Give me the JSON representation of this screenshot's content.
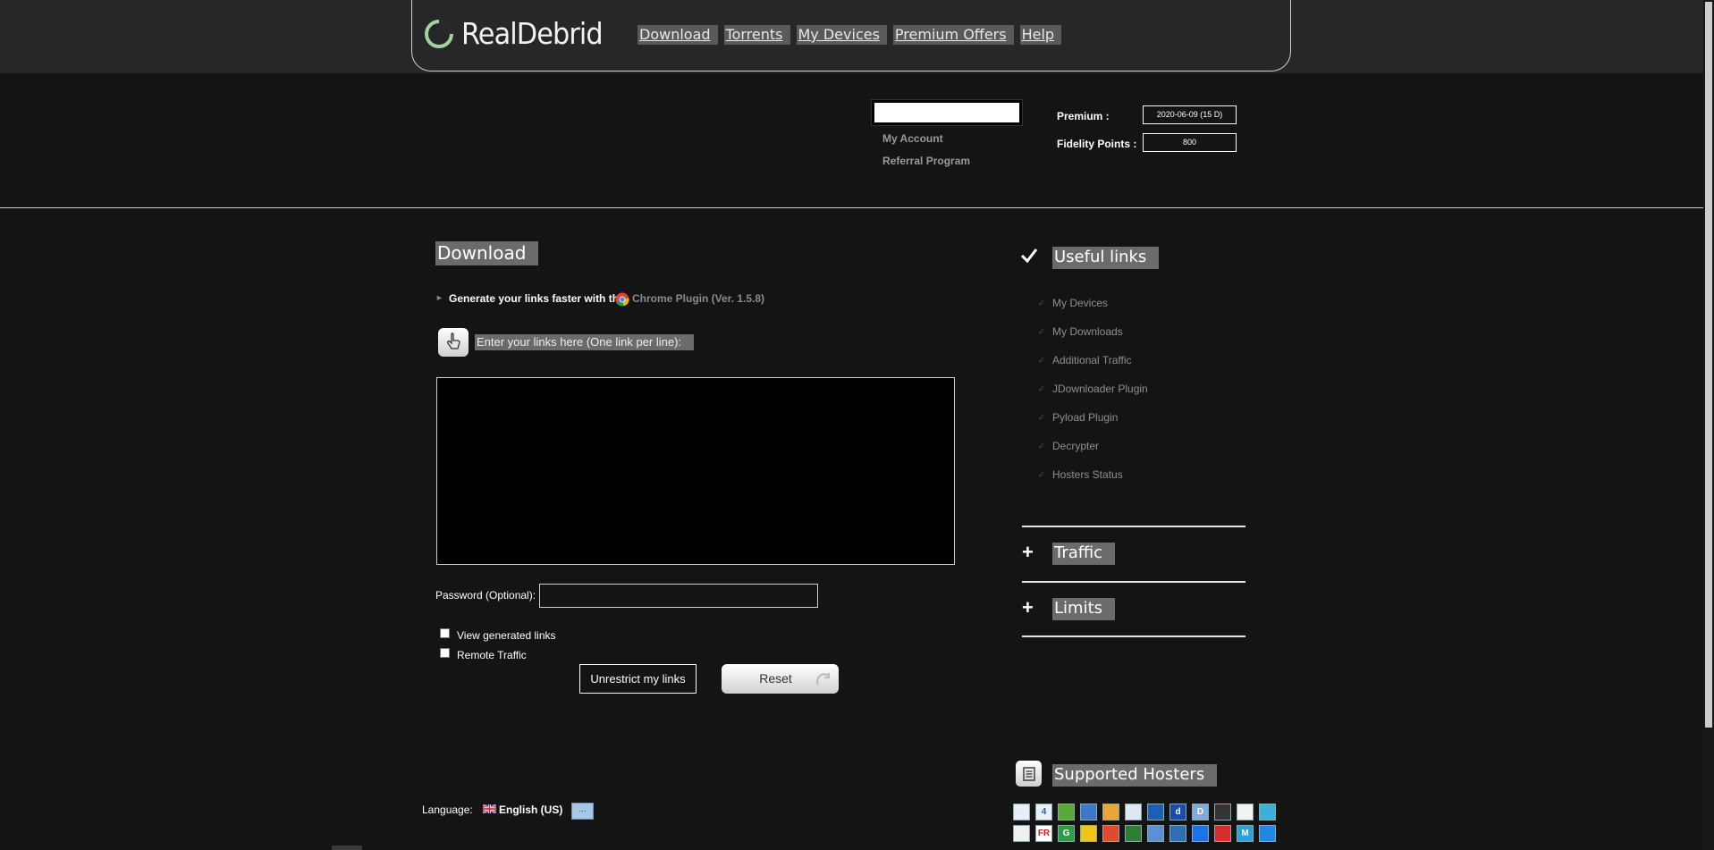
{
  "header": {
    "logo_text": "RealDebrid",
    "nav": [
      "Download",
      "Torrents",
      "My Devices",
      "Premium Offers",
      "Help"
    ]
  },
  "account": {
    "links": [
      "My Account",
      "Referral Program"
    ],
    "premium_label": "Premium :",
    "premium_value": "2020-06-09  (15 D)",
    "fidelity_label": "Fidelity Points :",
    "fidelity_value": "800"
  },
  "download": {
    "title": "Download",
    "generate_text": "Generate your links faster with the",
    "plugin_link": "Chrome Plugin (Ver. 1.5.8)",
    "enter_label": "Enter your links here (One link per line):",
    "links_value": "",
    "password_label": "Password (Optional):",
    "password_value": "",
    "view_generated_label": "View generated links",
    "remote_traffic_label": "Remote Traffic",
    "unrestrict_label": "Unrestrict my links",
    "reset_label": "Reset"
  },
  "language": {
    "label": "Language:",
    "value": "English (US)",
    "button": "..."
  },
  "sidebar": {
    "useful_links_title": "Useful links",
    "useful_links": [
      "My Devices",
      "My Downloads",
      "Additional Traffic",
      "JDownloader Plugin",
      "Pyload Plugin",
      "Decrypter",
      "Hosters Status"
    ],
    "traffic_title": "Traffic",
    "limits_title": "Limits",
    "supported_hosters_title": "Supported Hosters"
  },
  "hosters": {
    "row1": [
      "",
      "4",
      "",
      "",
      "",
      "",
      "",
      "d",
      "D",
      "",
      "",
      ""
    ],
    "row2": [
      "",
      "FR",
      "G",
      "",
      "",
      "",
      "",
      "",
      "",
      "",
      "M",
      ""
    ]
  },
  "colors": {
    "background": "#141414",
    "header_band": "#262626",
    "label_highlight": "#6b6b6b",
    "muted_link": "#8f8f8f"
  }
}
